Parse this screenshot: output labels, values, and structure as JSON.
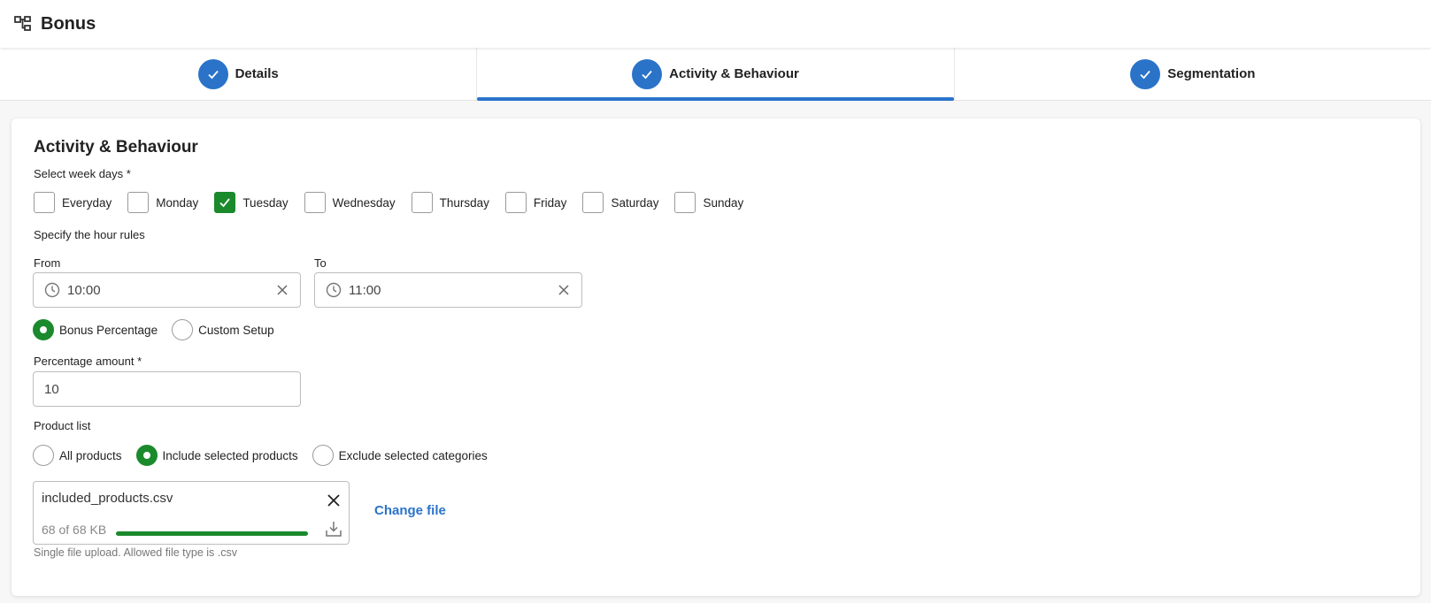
{
  "header": {
    "title": "Bonus",
    "icon": "org-chart-icon"
  },
  "steps": [
    {
      "label": "Details",
      "completed": true,
      "active": false
    },
    {
      "label": "Activity & Behaviour",
      "completed": true,
      "active": true
    },
    {
      "label": "Segmentation",
      "completed": true,
      "active": false
    }
  ],
  "form": {
    "section_title": "Activity & Behaviour",
    "weekdays_label": "Select week days *",
    "weekdays": [
      {
        "label": "Everyday",
        "checked": false
      },
      {
        "label": "Monday",
        "checked": false
      },
      {
        "label": "Tuesday",
        "checked": true
      },
      {
        "label": "Wednesday",
        "checked": false
      },
      {
        "label": "Thursday",
        "checked": false
      },
      {
        "label": "Friday",
        "checked": false
      },
      {
        "label": "Saturday",
        "checked": false
      },
      {
        "label": "Sunday",
        "checked": false
      }
    ],
    "hour_rules_label": "Specify the hour rules",
    "from_label": "From",
    "from_value": "10:00",
    "to_label": "To",
    "to_value": "11:00",
    "bonus_type": [
      {
        "label": "Bonus Percentage",
        "selected": true
      },
      {
        "label": "Custom Setup",
        "selected": false
      }
    ],
    "percentage_label": "Percentage amount *",
    "percentage_value": "10",
    "product_list_label": "Product list",
    "product_options": [
      {
        "label": "All products",
        "selected": false
      },
      {
        "label": "Include selected products",
        "selected": true
      },
      {
        "label": "Exclude selected categories",
        "selected": false
      }
    ],
    "file": {
      "name": "included_products.csv",
      "size_text": "68 of 68 KB",
      "progress": 1.0
    },
    "change_file_label": "Change file",
    "upload_hint": "Single file upload. Allowed file type is .csv"
  },
  "colors": {
    "accent_blue": "#2a73c9",
    "success_green": "#1b8a2d"
  }
}
